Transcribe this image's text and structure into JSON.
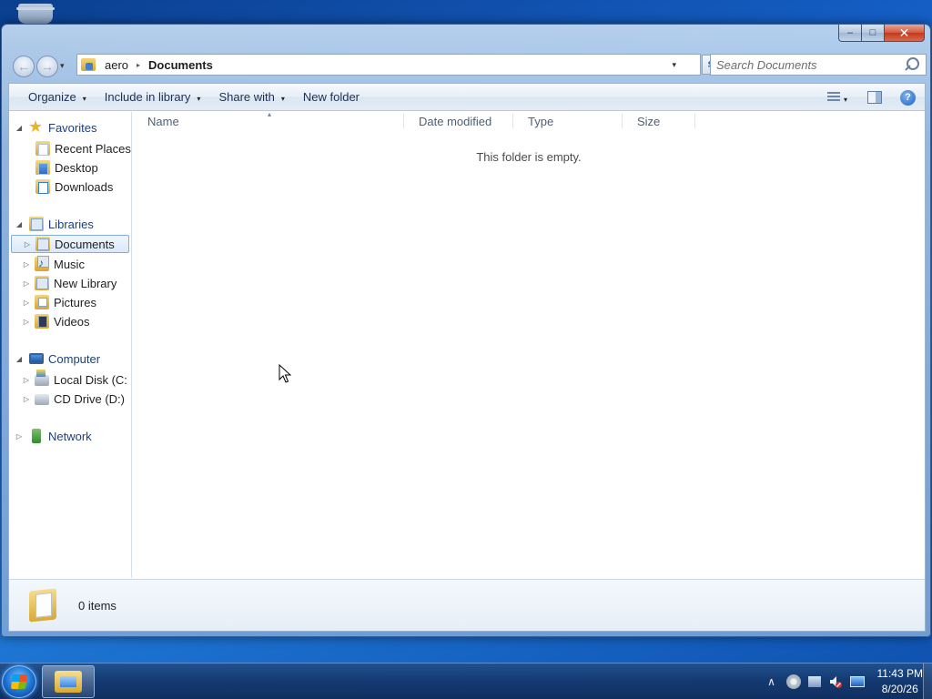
{
  "window": {
    "caption_buttons": {
      "minimize": "–",
      "maximize": "□",
      "close": "✕"
    }
  },
  "navbar": {
    "back_glyph": "←",
    "forward_glyph": "→",
    "dropdown_glyph": "▾",
    "breadcrumb": [
      "aero",
      "Documents"
    ],
    "breadcrumb_sep": "▸",
    "address_arrow": "▾",
    "refresh_glyph": "⇆",
    "search_placeholder": "Search Documents"
  },
  "commandbar": {
    "organize": "Organize",
    "include_in_library": "Include in library",
    "share_with": "Share with",
    "new_folder": "New folder",
    "caret": "▾",
    "help": "?"
  },
  "navpane": {
    "favorites": {
      "label": "Favorites",
      "items": [
        "Recent Places",
        "Desktop",
        "Downloads"
      ]
    },
    "libraries": {
      "label": "Libraries",
      "items": [
        "Documents",
        "Music",
        "New Library",
        "Pictures",
        "Videos"
      ],
      "selected": "Documents"
    },
    "computer": {
      "label": "Computer",
      "items": [
        "Local Disk (C:",
        "CD Drive (D:)"
      ]
    },
    "network": {
      "label": "Network"
    },
    "expanded_glyph": "◢",
    "collapsed_glyph": "▷"
  },
  "filelist": {
    "columns": [
      "Name",
      "Date modified",
      "Type",
      "Size"
    ],
    "sort_glyph": "▴",
    "empty_message": "This folder is empty."
  },
  "details": {
    "item_count": "0 items"
  },
  "taskbar": {
    "clock_time": "11:43 PM",
    "clock_date": "8/20/26",
    "tray_up_arrow": "∧"
  },
  "colors": {
    "desktop": "#1560c8",
    "window_frame": "#98bae0",
    "nav_group_text": "#1e3f7a",
    "selection_border": "#84acdd",
    "close_button": "#c2391c"
  }
}
